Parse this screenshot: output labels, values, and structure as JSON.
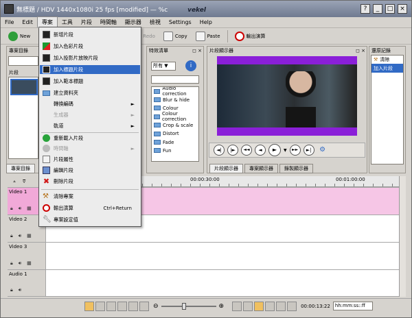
{
  "window": {
    "title": "無標題 / HDV 1440x1080i 25 fps [modified] — %c",
    "brand": "vekel",
    "controls": [
      "?",
      "_",
      "□",
      "×"
    ]
  },
  "menubar": [
    "File",
    "Edit",
    "專案",
    "工具",
    "片段",
    "時間軸",
    "顯示器",
    "檢視",
    "Settings",
    "Help"
  ],
  "toolbar": {
    "new": "New",
    "redo": "Redo",
    "copy": "Copy",
    "paste": "Paste",
    "render": "輸出演算"
  },
  "left_panel": {
    "title": "專案目錄",
    "clip_header": "片段",
    "tab": "專案目錄"
  },
  "effects_panel": {
    "title": "特效清單",
    "filter": "所有",
    "items": [
      "Audio correction",
      "Blur & hide",
      "Colour",
      "Colour correction",
      "Crop & scale",
      "Distort",
      "Fade",
      "Fun"
    ]
  },
  "monitor_panel": {
    "title": "片段顯示器",
    "tabs": [
      "片段顯示器",
      "專案顯示器",
      "錄製顯示器"
    ],
    "transport": [
      "◄|",
      "|►",
      "◄◄",
      "◄",
      "►",
      "▼",
      "►►",
      "►|",
      "⚙"
    ]
  },
  "history_panel": {
    "title": "還原記錄",
    "items": [
      "清除",
      "加入片段"
    ]
  },
  "popup_menu": {
    "items": [
      {
        "label": "新增片段",
        "icon": "film-icon"
      },
      {
        "label": "加入色彩片段",
        "icon": "color-clip-icon"
      },
      {
        "label": "加入投影片放映片段",
        "icon": "slideshow-icon"
      },
      {
        "label": "加入標題片段",
        "icon": "title-clip-icon"
      },
      {
        "label": "加入範本標題",
        "icon": "template-title-icon"
      },
      {
        "label": "建立資料夾",
        "icon": "folder-icon"
      },
      {
        "label": "轉換編碼",
        "icon": "",
        "arrow": "►"
      },
      {
        "label": "生成器",
        "icon": "",
        "arrow": "►"
      },
      {
        "label": "軌道",
        "icon": "",
        "arrow": "►"
      },
      {
        "label": "重新載入片段",
        "icon": "reload-icon"
      },
      {
        "label": "時間軸",
        "icon": "timeline-icon",
        "arrow": "►"
      },
      {
        "label": "片段屬性",
        "icon": "properties-icon"
      },
      {
        "label": "編輯片段",
        "icon": "edit-icon"
      },
      {
        "label": "刪除片段",
        "icon": "delete-icon"
      },
      {
        "label": "清除專案",
        "icon": "clean-icon"
      },
      {
        "label": "輸出演算",
        "icon": "render-icon",
        "shortcut": "Ctrl+Return"
      },
      {
        "label": "專案設定值",
        "icon": "settings-icon"
      }
    ]
  },
  "timeline": {
    "ruler": [
      "00:00:30:00",
      "00:01:00:00"
    ],
    "tracks": [
      "Video 1",
      "Video 2",
      "Video 3",
      "Audio 1"
    ]
  },
  "bottombar": {
    "timecode": "00:00:13:22",
    "format": "hh:mm:ss::ff"
  },
  "colors": {
    "selection": "#316ac5",
    "track_clip": "#f6c6e6",
    "monitor_frame": "#8a1fd8"
  }
}
